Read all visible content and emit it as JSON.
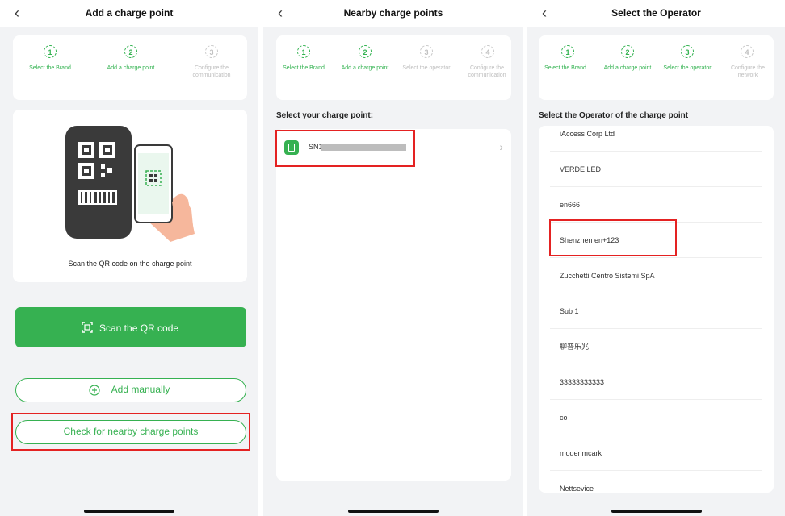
{
  "screen1": {
    "title": "Add a charge point",
    "steps": [
      {
        "num": "1",
        "label": "Select the Brand"
      },
      {
        "num": "2",
        "label": "Add a charge point"
      },
      {
        "num": "3",
        "label": "Configure the communication"
      }
    ],
    "scan_caption": "Scan the QR code on the charge point",
    "scan_button": "Scan the QR code",
    "add_manually": "Add manually",
    "check_nearby": "Check for nearby charge points"
  },
  "screen2": {
    "title": "Nearby charge points",
    "steps": [
      {
        "num": "1",
        "label": "Select the Brand"
      },
      {
        "num": "2",
        "label": "Add a charge point"
      },
      {
        "num": "3",
        "label": "Select the operator"
      },
      {
        "num": "4",
        "label": "Configure the communication"
      }
    ],
    "section_label": "Select your charge point:",
    "device_prefix": "SN1("
  },
  "screen3": {
    "title": "Select the Operator",
    "steps": [
      {
        "num": "1",
        "label": "Select the Brand"
      },
      {
        "num": "2",
        "label": "Add a charge point"
      },
      {
        "num": "3",
        "label": "Select the operator"
      },
      {
        "num": "4",
        "label": "Configure the network"
      }
    ],
    "section_label": "Select the Operator of the charge point",
    "operators": [
      "iAccess Corp Ltd",
      "VERDE LED",
      "en666",
      "Shenzhen en+123",
      "Zucchetti Centro Sistemi SpA",
      "Sub 1",
      "聊普乐兆",
      "33333333333",
      "co",
      "modenmcark",
      "Nettsevice"
    ]
  },
  "colors": {
    "accent": "#36b151",
    "highlight": "#e42222",
    "background": "#f2f3f5"
  }
}
